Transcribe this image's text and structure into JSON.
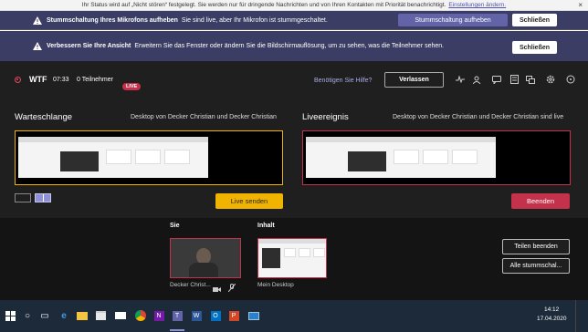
{
  "status_bar": {
    "text": "Ihr Status wird auf „Nicht stören“ festgelegt. Sie werden nur für dringende Nachrichten und von Ihren Kontakten mit Priorität benachrichtigt.",
    "link": "Einstellungen ändern.",
    "close": "×"
  },
  "banner_mic": {
    "bold": "Stummschaltung Ihres Mikrofons aufheben",
    "text": "Sie sind live, aber Ihr Mikrofon ist stummgeschaltet.",
    "action": "Stummschaltung aufheben",
    "close": "Schließen"
  },
  "banner_view": {
    "bold": "Verbessern Sie Ihre Ansicht",
    "text": "Erweitern Sie das Fenster oder ändern Sie die Bildschirmauflösung, um zu sehen, was die Teilnehmer sehen.",
    "close": "Schließen"
  },
  "meeting": {
    "title": "WTF",
    "time": "07:33",
    "participants": "0 Teilnehmer",
    "live_badge": "LIVE",
    "help": "Benötigen Sie Hilfe?",
    "leave": "Verlassen",
    "toolbar_icons": [
      "health-icon",
      "people-icon",
      "chat-icon",
      "notes-icon",
      "qa-icon",
      "info-icon",
      "settings-icon",
      "more-icon"
    ]
  },
  "queue": {
    "title": "Warteschlange",
    "subtitle": "Desktop von Decker Christian und Decker Christian",
    "send_live": "Live senden"
  },
  "live": {
    "title": "Liveereignis",
    "subtitle": "Desktop von Decker Christian und Decker Christian sind live",
    "end": "Beenden"
  },
  "sources": {
    "you_label": "Sie",
    "content_label": "Inhalt",
    "person_name": "Decker Christ...",
    "desktop_name": "Mein Desktop",
    "stop_share": "Teilen beenden",
    "mute_all": "Alle stummschal..."
  },
  "taskbar": {
    "time": "14:12",
    "date": "17.04.2020",
    "apps": [
      "windows-icon",
      "search-icon",
      "taskview-icon",
      "edge-icon",
      "explorer-icon",
      "store-icon",
      "mail-icon",
      "chrome-icon",
      "onenote-icon",
      "teams-icon",
      "word-icon",
      "outlook-icon",
      "powerpoint-icon",
      "photos-icon"
    ]
  },
  "colors": {
    "accent": "#6264a7",
    "live_red": "#c4314b",
    "queue_yellow": "#f0b400",
    "banner_bg": "#3b3d64"
  }
}
